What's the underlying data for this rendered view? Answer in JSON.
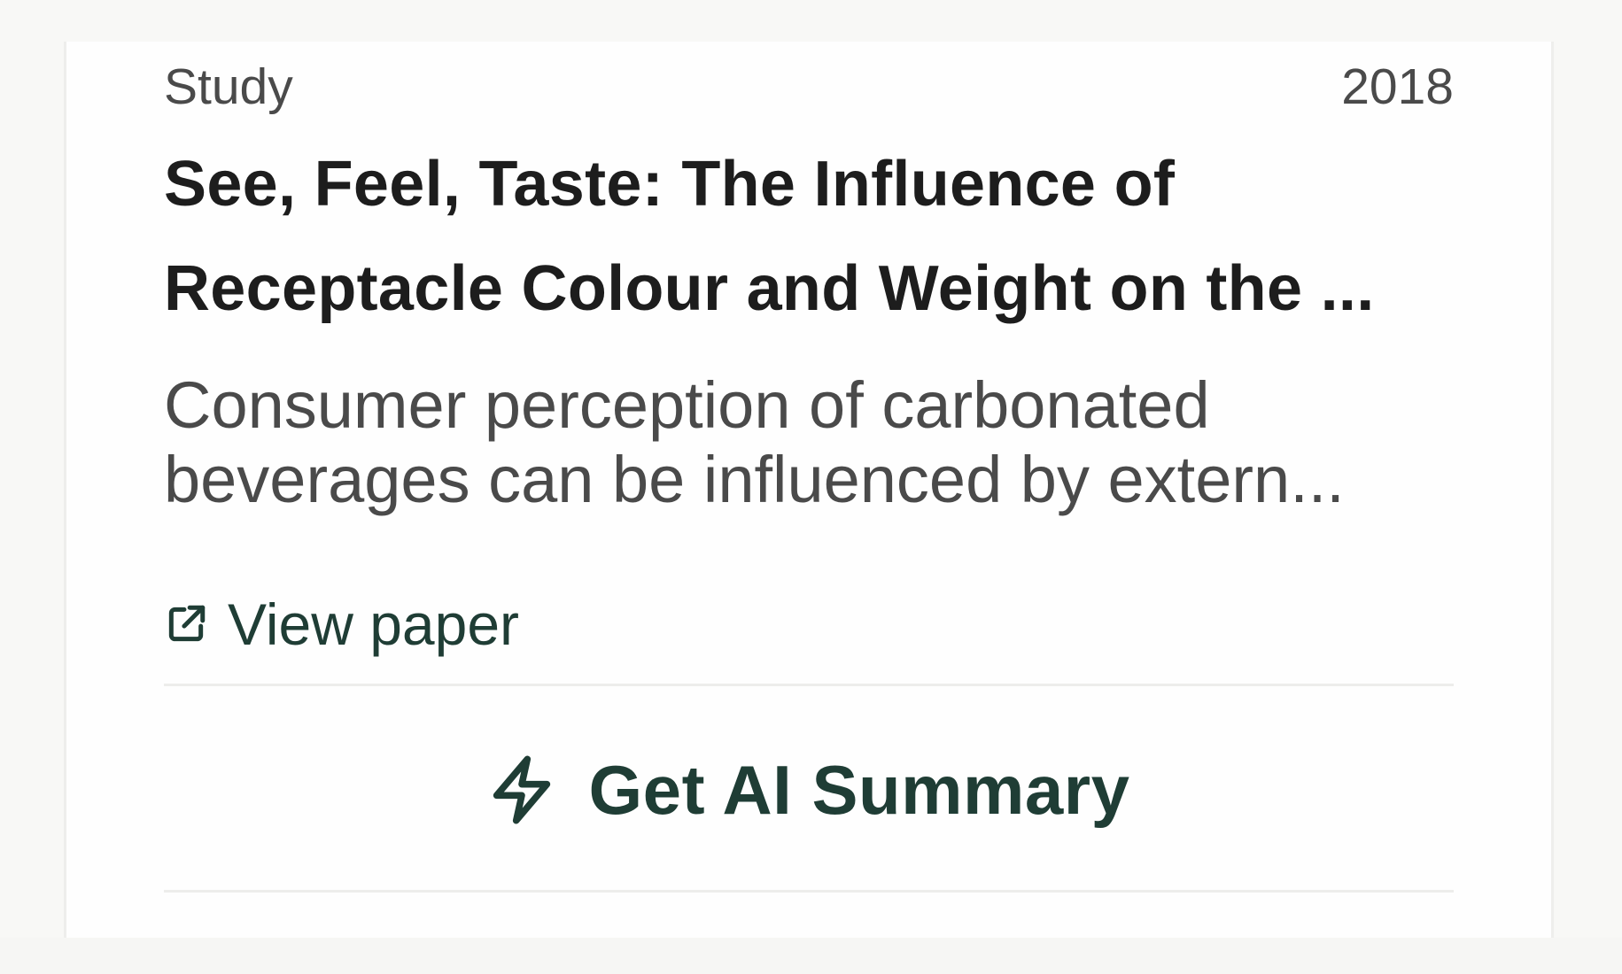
{
  "result_card": {
    "type_label": "Study",
    "year": "2018",
    "title_lines": [
      "See, Feel, Taste: The Influence of",
      "Receptacle Colour and Weight on the ..."
    ],
    "abstract_lines": [
      "Consumer perception of carbonated",
      "beverages can be influenced by extern..."
    ],
    "view_paper_label": "View paper",
    "view_paper_icon": "external-link-icon",
    "summary_button_label": "Get AI Summary",
    "summary_button_icon": "lightning-bolt-icon"
  },
  "colors": {
    "accent": "#1f3d35",
    "title_text": "#1d1d1d",
    "secondary_text": "#4a4a4a",
    "divider": "#ededeb"
  }
}
